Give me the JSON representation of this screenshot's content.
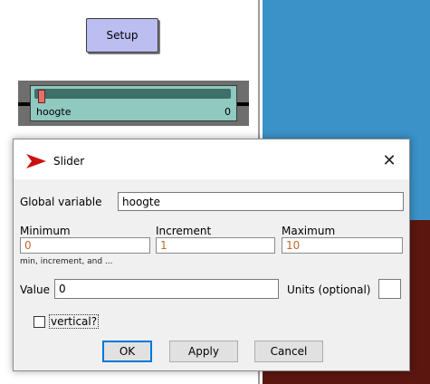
{
  "interface": {
    "setup_button": {
      "label": "Setup"
    },
    "slider": {
      "name": "hoogte",
      "value": "0"
    }
  },
  "dialog": {
    "title": "Slider",
    "close_glyph": "✕",
    "global_variable": {
      "label": "Global variable",
      "value": "hoogte"
    },
    "minimum": {
      "label": "Minimum",
      "value": "0"
    },
    "increment": {
      "label": "Increment",
      "value": "1"
    },
    "maximum": {
      "label": "Maximum",
      "value": "10"
    },
    "hint": "min, increment, and ...",
    "value": {
      "label": "Value",
      "value": "0"
    },
    "units": {
      "label": "Units (optional)",
      "value": ""
    },
    "vertical": {
      "label": "vertical?",
      "checked": false
    },
    "buttons": {
      "ok": "OK",
      "apply": "Apply",
      "cancel": "Cancel"
    }
  },
  "colors": {
    "world_blue": "#3a92c8",
    "world_dark_red": "#5b1610",
    "setup_button": "#bcbdf0",
    "slider_body": "#8fc9c0",
    "title_icon_red": "#cc1010"
  }
}
